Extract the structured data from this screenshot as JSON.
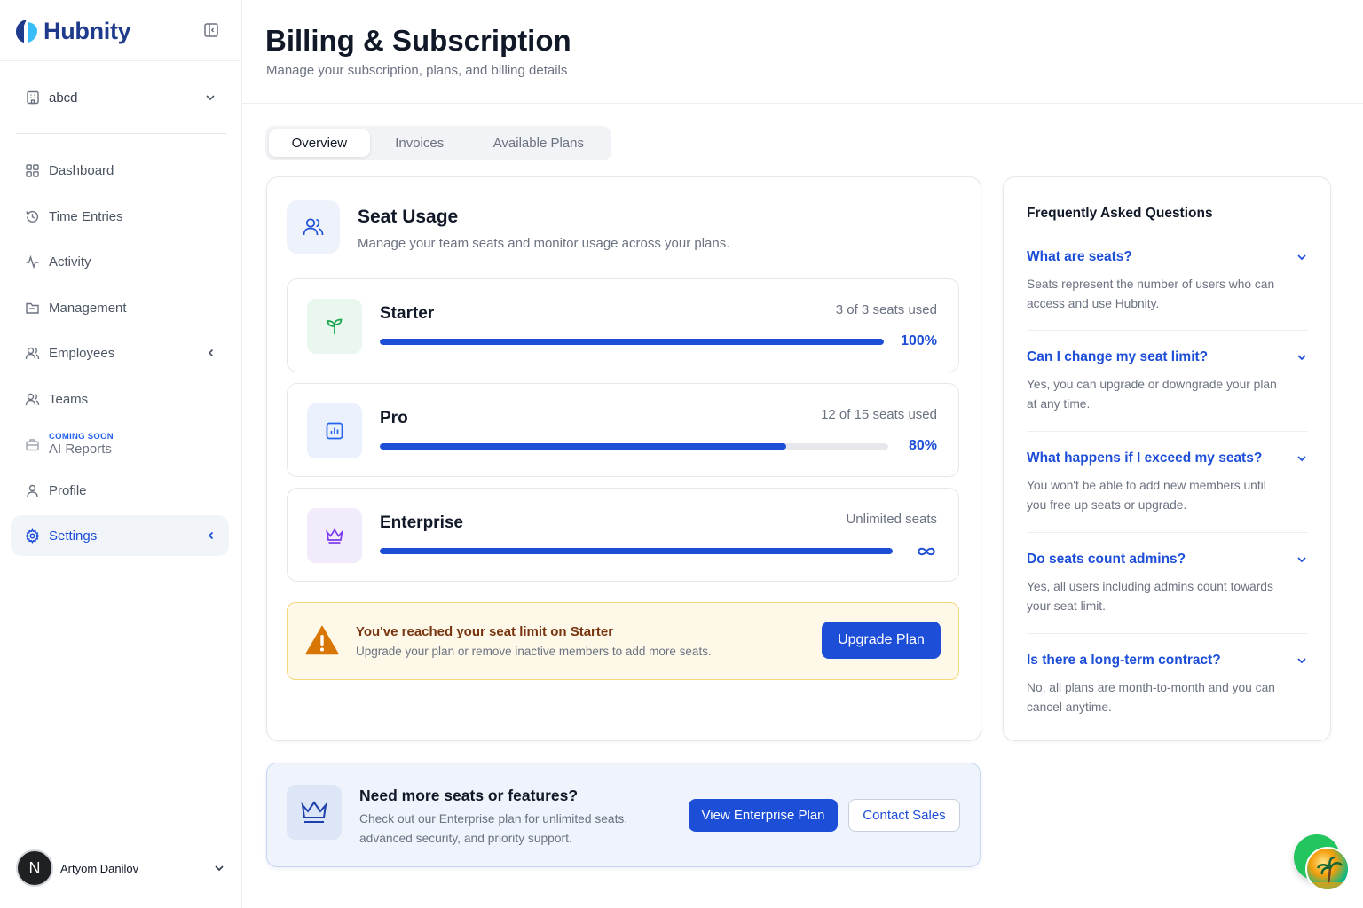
{
  "brand": {
    "name": "Hubnity"
  },
  "workspace": {
    "name": "abcd"
  },
  "sidebar": {
    "items": [
      {
        "label": "Dashboard",
        "icon": "grid-icon"
      },
      {
        "label": "Time Entries",
        "icon": "history-clock-icon"
      },
      {
        "label": "Activity",
        "icon": "activity-icon"
      },
      {
        "label": "Management",
        "icon": "folder-icon"
      },
      {
        "label": "Employees",
        "icon": "users-icon"
      },
      {
        "label": "Teams",
        "icon": "users-icon"
      },
      {
        "label": "AI Reports",
        "badge": "COMING SOON",
        "icon": "briefcase-icon"
      },
      {
        "label": "Profile",
        "icon": "user-icon"
      },
      {
        "label": "Settings",
        "icon": "gear-icon",
        "active": true
      }
    ]
  },
  "user": {
    "initial": "N",
    "name": "Artyom Danilov"
  },
  "header": {
    "title": "Billing & Subscription",
    "subtitle": "Manage your subscription, plans, and billing details"
  },
  "tabs": [
    {
      "label": "Overview",
      "active": true
    },
    {
      "label": "Invoices"
    },
    {
      "label": "Available Plans"
    }
  ],
  "seat_usage": {
    "title": "Seat Usage",
    "description": "Manage your team seats and monitor usage across your plans.",
    "plans": [
      {
        "name": "Starter",
        "usage": "3 of 3 seats used",
        "percent_label": "100%",
        "fill": 1.0,
        "icon": "sprout-icon",
        "icon_color": "#16a34a",
        "icon_bg": "#e9f7ee"
      },
      {
        "name": "Pro",
        "usage": "12 of 15 seats used",
        "percent_label": "80%",
        "fill": 0.8,
        "icon": "bar-chart-icon",
        "icon_color": "#2563eb",
        "icon_bg": "#eaf0fc"
      },
      {
        "name": "Enterprise",
        "usage": "Unlimited seats",
        "fill": 1.0,
        "icon": "crown-icon",
        "icon_color": "#7c3aed",
        "icon_bg": "#f1ebfb"
      }
    ],
    "alert": {
      "title": "You've reached your seat limit on Starter",
      "description": "Upgrade your plan or remove inactive members to add more seats.",
      "button": "Upgrade Plan"
    }
  },
  "faq": {
    "heading": "Frequently Asked Questions",
    "items": [
      {
        "q": "What are seats?",
        "a": "Seats represent the number of users who can access and use Hubnity."
      },
      {
        "q": "Can I change my seat limit?",
        "a": "Yes, you can upgrade or downgrade your plan at any time."
      },
      {
        "q": "What happens if I exceed my seats?",
        "a": "You won't be able to add new members until you free up seats or upgrade."
      },
      {
        "q": "Do seats count admins?",
        "a": "Yes, all users including admins count towards your seat limit."
      },
      {
        "q": "Is there a long-term contract?",
        "a": "No, all plans are month-to-month and you can cancel anytime."
      }
    ]
  },
  "promo": {
    "title": "Need more seats or features?",
    "description": "Check out our Enterprise plan for unlimited seats, advanced security, and priority support.",
    "primary_button": "View Enterprise Plan",
    "secondary_button": "Contact Sales"
  },
  "colors": {
    "accent": "#1d4ed8",
    "warning_bg": "#fdf8e8",
    "warning_border": "#f6d77c",
    "warning_icon": "#d97706"
  }
}
